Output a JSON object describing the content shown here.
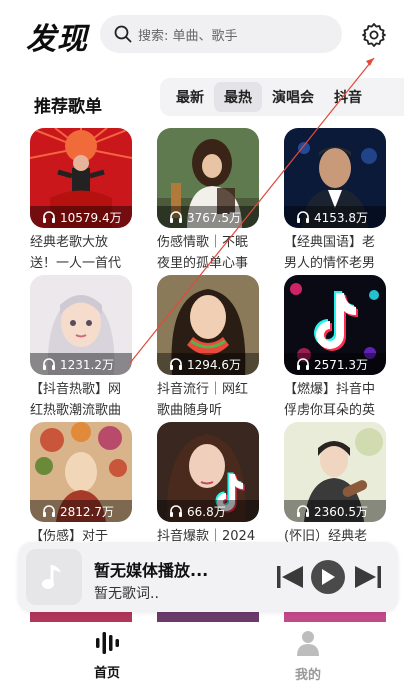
{
  "header": {
    "title": "发现",
    "search_placeholder": "搜索: 单曲、歌手",
    "search_icon": "search-icon",
    "settings_icon": "gear-icon"
  },
  "section": {
    "title": "推荐歌单",
    "tabs": [
      {
        "label": "最新",
        "active": false
      },
      {
        "label": "最热",
        "active": true
      },
      {
        "label": "演唱会",
        "active": false
      },
      {
        "label": "抖音",
        "active": false
      }
    ]
  },
  "playlists": [
    {
      "plays": "10579.4万",
      "name": "经典老歌大放送！一人一首代"
    },
    {
      "plays": "3767.5万",
      "name": "伤感情歌｜不眠夜里的孤单心事"
    },
    {
      "plays": "4153.8万",
      "name": "【经典国语】老男人的情怀老男"
    },
    {
      "plays": "1231.2万",
      "name": "【抖音热歌】网红热歌潮流歌曲"
    },
    {
      "plays": "1294.6万",
      "name": "抖音流行｜网红歌曲随身听"
    },
    {
      "plays": "2571.3万",
      "name": "【燃爆】抖音中俘虏你耳朵的英"
    },
    {
      "plays": "2812.7万",
      "name": "【伤感】对于"
    },
    {
      "plays": "66.8万",
      "name": "抖音爆款｜2024"
    },
    {
      "plays": "2360.5万",
      "name": "(怀旧）经典老"
    }
  ],
  "player": {
    "title": "暂无媒体播放...",
    "subtitle": "暂无歌词..",
    "icons": [
      "music-note-icon",
      "previous-icon",
      "play-icon",
      "next-icon"
    ]
  },
  "nav": {
    "home_label": "首页",
    "me_label": "我的",
    "home_icon": "bars-icon",
    "me_icon": "person-icon"
  },
  "colors": {
    "accent": "#111111",
    "annotation_line": "#e04a3a",
    "inactive_nav": "#999999"
  }
}
